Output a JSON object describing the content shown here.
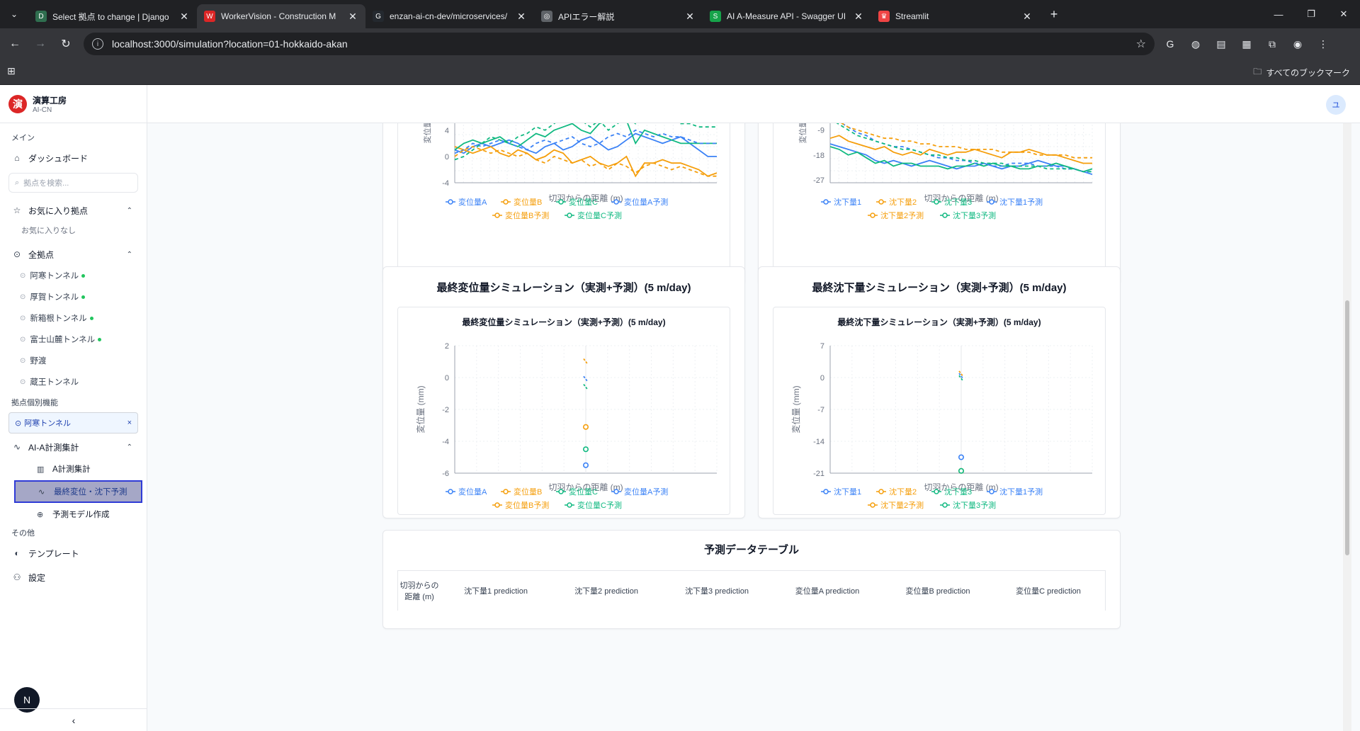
{
  "browser": {
    "tabs": [
      {
        "title": "Select 拠点 to change | Django",
        "fav": "D",
        "color": "#2f6e4f"
      },
      {
        "title": "WorkerVision - Construction M",
        "fav": "W",
        "color": "#dc2626"
      },
      {
        "title": "enzan-ai-cn-dev/microservices/",
        "fav": "G",
        "color": "#24292f"
      },
      {
        "title": "APIエラー解説",
        "fav": "◎",
        "color": "#5f6368"
      },
      {
        "title": "AI A-Measure API - Swagger UI",
        "fav": "S",
        "color": "#16a34a"
      },
      {
        "title": "Streamlit",
        "fav": "♛",
        "color": "#ef4444"
      }
    ],
    "url": "localhost:3000/simulation?location=01-hokkaido-akan",
    "bookmarks_all": "すべてのブックマーク"
  },
  "brand": {
    "name": "演算工房",
    "sub": "AI-CN",
    "logo": "演"
  },
  "sidebar": {
    "main_label": "メイン",
    "dashboard": "ダッシュボード",
    "search_placeholder": "拠点を検索...",
    "favorites": "お気に入り拠点",
    "favorites_empty": "お気に入りなし",
    "all_locations": "全拠点",
    "locations": [
      {
        "name": "阿寒トンネル",
        "active": true
      },
      {
        "name": "厚賀トンネル",
        "active": true
      },
      {
        "name": "新箱根トンネル",
        "active": true
      },
      {
        "name": "富士山麓トンネル",
        "active": true
      },
      {
        "name": "野渡",
        "active": false
      },
      {
        "name": "蔵王トンネル",
        "active": false
      }
    ],
    "location_features": "拠点個別機能",
    "selected_location": "阿寒トンネル",
    "ai_group": "AI-A計測集計",
    "ai_items": [
      "A計測集計",
      "最終変位・沈下予測",
      "予測モデル作成"
    ],
    "other_label": "その他",
    "templates": "テンプレート",
    "settings": "設定",
    "user_initial": "N",
    "collapse": "‹"
  },
  "topbar": {
    "user_initial": "ユ"
  },
  "charts_top": {
    "left": {
      "xlabel": "切羽からの距離 (m)",
      "ylabel": "変位量",
      "yticks": [
        "4",
        "0",
        "-4"
      ],
      "legend_row1": [
        "変位量A",
        "変位量B",
        "変位量C",
        "変位量A予測"
      ],
      "legend_row2": [
        "変位量B予測",
        "変位量C予測"
      ]
    },
    "right": {
      "xlabel": "切羽からの距離 (m)",
      "ylabel": "変位量",
      "yticks": [
        "-9",
        "-18",
        "-27"
      ],
      "legend_row1": [
        "沈下量1",
        "沈下量2",
        "沈下量3",
        "沈下量1予測"
      ],
      "legend_row2": [
        "沈下量2予測",
        "沈下量3予測"
      ]
    }
  },
  "sim_left": {
    "card_title": "最終変位量シミュレーション（実測+予測）(5 m/day)",
    "chart_title": "最終変位量シミュレーション（実測+予測）(5 m/day)",
    "xlabel": "切羽からの距離 (m)",
    "ylabel": "変位量 (mm)",
    "yticks": [
      "2",
      "0",
      "-2",
      "-4",
      "-6"
    ],
    "legend_row1": [
      "変位量A",
      "変位量B",
      "変位量C",
      "変位量A予測"
    ],
    "legend_row2": [
      "変位量B予測",
      "変位量C予測"
    ]
  },
  "sim_right": {
    "card_title": "最終沈下量シミュレーション（実測+予測）(5 m/day)",
    "chart_title": "最終沈下量シミュレーション（実測+予測）(5 m/day)",
    "xlabel": "切羽からの距離 (m)",
    "ylabel": "変位量 (mm)",
    "yticks": [
      "7",
      "0",
      "-7",
      "-14",
      "-21"
    ],
    "legend_row1": [
      "沈下量1",
      "沈下量2",
      "沈下量3",
      "沈下量1予測"
    ],
    "legend_row2": [
      "沈下量2予測",
      "沈下量3予測"
    ]
  },
  "table": {
    "title": "予測データテーブル",
    "headers": [
      "切羽からの距離 (m)",
      "沈下量1 prediction",
      "沈下量2 prediction",
      "沈下量3 prediction",
      "変位量A prediction",
      "変位量B prediction",
      "変位量C prediction"
    ]
  },
  "colors": {
    "blue": "#3b82f6",
    "orange": "#f59e0b",
    "green": "#10b981"
  },
  "chart_data": [
    {
      "type": "line",
      "xlabel": "切羽からの距離 (m)",
      "ylabel": "変位量",
      "ylim": [
        -4,
        8
      ],
      "series": [
        {
          "name": "変位量A",
          "values": [
            1,
            0.5,
            1.5,
            2,
            1.5,
            2,
            2.5,
            2,
            1,
            0.5,
            1.5,
            2,
            1,
            1.5,
            2.5,
            3,
            2,
            1,
            1.5,
            2.5,
            3.5,
            3,
            2.5,
            2,
            2.5,
            3,
            2,
            1,
            0,
            0
          ]
        },
        {
          "name": "変位量B",
          "values": [
            1.5,
            1,
            0.5,
            1,
            1.5,
            0.5,
            0,
            1,
            0.5,
            -0.5,
            0,
            1,
            0.5,
            -1,
            -0.5,
            0,
            -1,
            -1.5,
            -1,
            0,
            -3,
            -1,
            -1,
            -0.5,
            -1,
            -1,
            -1.5,
            -2,
            -3,
            -2.5
          ]
        },
        {
          "name": "変位量C",
          "values": [
            1,
            2,
            2.5,
            2,
            2.5,
            3,
            2,
            1.5,
            2.5,
            3.5,
            3,
            4,
            4.5,
            5,
            4,
            3.5,
            5,
            5.5,
            6,
            5.5,
            2,
            4,
            3.5,
            3,
            2.5,
            2,
            2,
            2,
            2,
            2
          ]
        },
        {
          "name": "変位量A予測",
          "values": [
            0.5,
            1,
            2,
            1.5,
            2,
            2.5,
            2,
            1.5,
            1,
            2,
            2.5,
            2,
            2.5,
            3,
            2,
            1.5,
            2,
            3,
            3.5,
            3,
            4,
            3.5,
            3,
            3.5,
            3,
            3,
            2.5,
            2,
            2,
            2
          ]
        },
        {
          "name": "変位量B予測",
          "values": [
            0,
            1,
            1.5,
            1,
            0.5,
            1,
            0.5,
            0,
            0.5,
            -0.5,
            -1,
            0,
            -0.5,
            -1,
            -0.5,
            -1.5,
            -1,
            -2,
            -1,
            -1.5,
            -2.5,
            -1.5,
            -1,
            -1.5,
            -2,
            -1.5,
            -2,
            -2.5,
            -3,
            -3
          ]
        },
        {
          "name": "変位量C予測",
          "values": [
            -0.5,
            0,
            1,
            2,
            3,
            2.5,
            2,
            3,
            3.5,
            4.5,
            4,
            5,
            6,
            7,
            5.5,
            4.5,
            5.5,
            4,
            5,
            6,
            5,
            7,
            6.5,
            6,
            5.5,
            5,
            5,
            4.5,
            4.5,
            4.5
          ]
        }
      ]
    },
    {
      "type": "line",
      "xlabel": "切羽からの距離 (m)",
      "ylabel": "変位量",
      "ylim": [
        -27,
        0
      ],
      "series": [
        {
          "name": "沈下量1",
          "values": [
            -14,
            -15,
            -16,
            -17,
            -18,
            -20,
            -21,
            -20,
            -21,
            -22,
            -21,
            -20,
            -21,
            -22,
            -23,
            -22,
            -22,
            -21,
            -22,
            -23,
            -22,
            -22,
            -21,
            -20,
            -21,
            -22,
            -22,
            -23,
            -24,
            -25
          ]
        },
        {
          "name": "沈下量2",
          "values": [
            -12,
            -11,
            -13,
            -14,
            -15,
            -16,
            -15,
            -17,
            -18,
            -17,
            -18,
            -16,
            -17,
            -18,
            -17,
            -17,
            -16,
            -17,
            -18,
            -19,
            -17,
            -17,
            -16,
            -17,
            -18,
            -18,
            -19,
            -20,
            -21,
            -21
          ]
        },
        {
          "name": "沈下量3",
          "values": [
            -15,
            -16,
            -18,
            -17,
            -19,
            -21,
            -20,
            -22,
            -21,
            -21,
            -22,
            -22,
            -22,
            -23,
            -22,
            -22,
            -21,
            -22,
            -21,
            -22,
            -22,
            -23,
            -23,
            -22,
            -22,
            -21,
            -22,
            -23,
            -24,
            -23
          ]
        },
        {
          "name": "沈下量1予測",
          "values": [
            -5,
            -6,
            -8,
            -10,
            -11,
            -13,
            -14,
            -15,
            -15,
            -16,
            -17,
            -18,
            -19,
            -19,
            -20,
            -20,
            -21,
            -21,
            -22,
            -22,
            -21,
            -21,
            -21,
            -22,
            -22,
            -22,
            -23,
            -23,
            -24,
            -24
          ]
        },
        {
          "name": "沈下量2予測",
          "values": [
            -4,
            -6,
            -8,
            -9,
            -10,
            -11,
            -12,
            -12,
            -13,
            -13,
            -14,
            -14,
            -15,
            -15,
            -15,
            -16,
            -16,
            -16,
            -16,
            -17,
            -17,
            -17,
            -17,
            -18,
            -18,
            -18,
            -18,
            -19,
            -19,
            -19
          ]
        },
        {
          "name": "沈下量3予測",
          "values": [
            -5,
            -7,
            -9,
            -11,
            -12,
            -13,
            -14,
            -15,
            -16,
            -16,
            -17,
            -18,
            -18,
            -19,
            -19,
            -20,
            -20,
            -21,
            -21,
            -21,
            -22,
            -22,
            -22,
            -22,
            -23,
            -23,
            -23,
            -23,
            -24,
            -24
          ]
        }
      ]
    },
    {
      "type": "scatter",
      "title": "最終変位量シミュレーション（実測+予測）(5 m/day)",
      "xlabel": "切羽からの距離 (m)",
      "ylabel": "変位量 (mm)",
      "ylim": [
        -6,
        2
      ],
      "series": [
        {
          "name": "変位量A",
          "values": [
            -5.5
          ]
        },
        {
          "name": "変位量B",
          "values": [
            -3.1
          ]
        },
        {
          "name": "変位量C",
          "values": [
            -4.5
          ]
        },
        {
          "name": "変位量A予測",
          "values": [
            -0.1
          ]
        },
        {
          "name": "変位量B予測",
          "values": [
            1.0
          ]
        },
        {
          "name": "変位量C予測",
          "values": [
            -0.6
          ]
        }
      ]
    },
    {
      "type": "scatter",
      "title": "最終沈下量シミュレーション（実測+予測）(5 m/day)",
      "xlabel": "切羽からの距離 (m)",
      "ylabel": "変位量 (mm)",
      "ylim": [
        -21,
        7
      ],
      "series": [
        {
          "name": "沈下量1",
          "values": [
            -17.5
          ]
        },
        {
          "name": "沈下量2",
          "values": [
            -20.5
          ]
        },
        {
          "name": "沈下量3",
          "values": [
            -20.5
          ]
        },
        {
          "name": "沈下量1予測",
          "values": [
            0.3
          ]
        },
        {
          "name": "沈下量2予測",
          "values": [
            0.8
          ]
        },
        {
          "name": "沈下量3予測",
          "values": [
            -0.2
          ]
        }
      ]
    }
  ]
}
